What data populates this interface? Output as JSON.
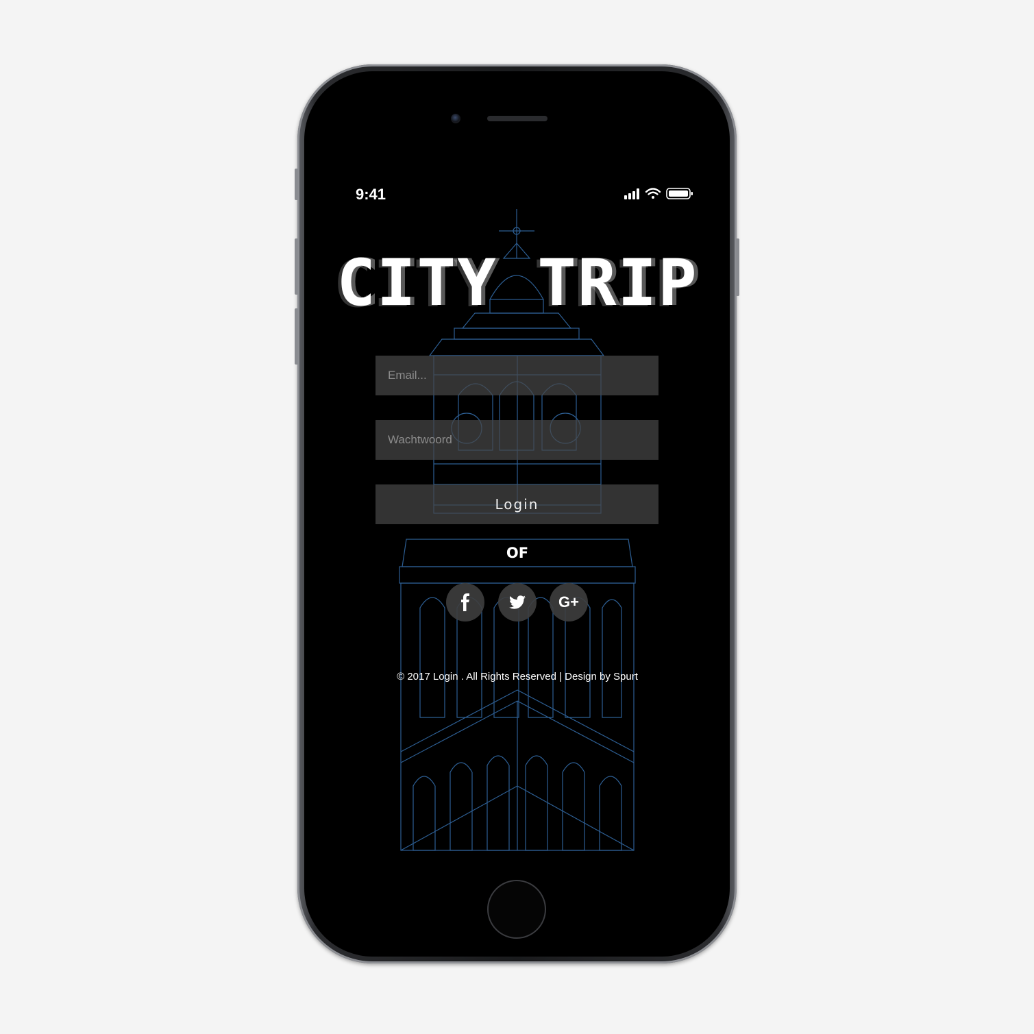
{
  "status_bar": {
    "time": "9:41"
  },
  "app": {
    "title": "CITY TRIP"
  },
  "form": {
    "email_placeholder": "Email...",
    "password_placeholder": "Wachtwoord",
    "login_label": "Login",
    "or_label": "OF"
  },
  "social": [
    {
      "icon": "facebook-icon",
      "glyph": "f"
    },
    {
      "icon": "twitter-icon",
      "glyph": ""
    },
    {
      "icon": "google-plus-icon",
      "glyph": "G+"
    }
  ],
  "footer": {
    "text": "© 2017 Login . All Rights Reserved | Design by Spurt"
  },
  "colors": {
    "background": "#000000",
    "accent_lines": "#3d7fc6",
    "field_bg": "#464646"
  }
}
